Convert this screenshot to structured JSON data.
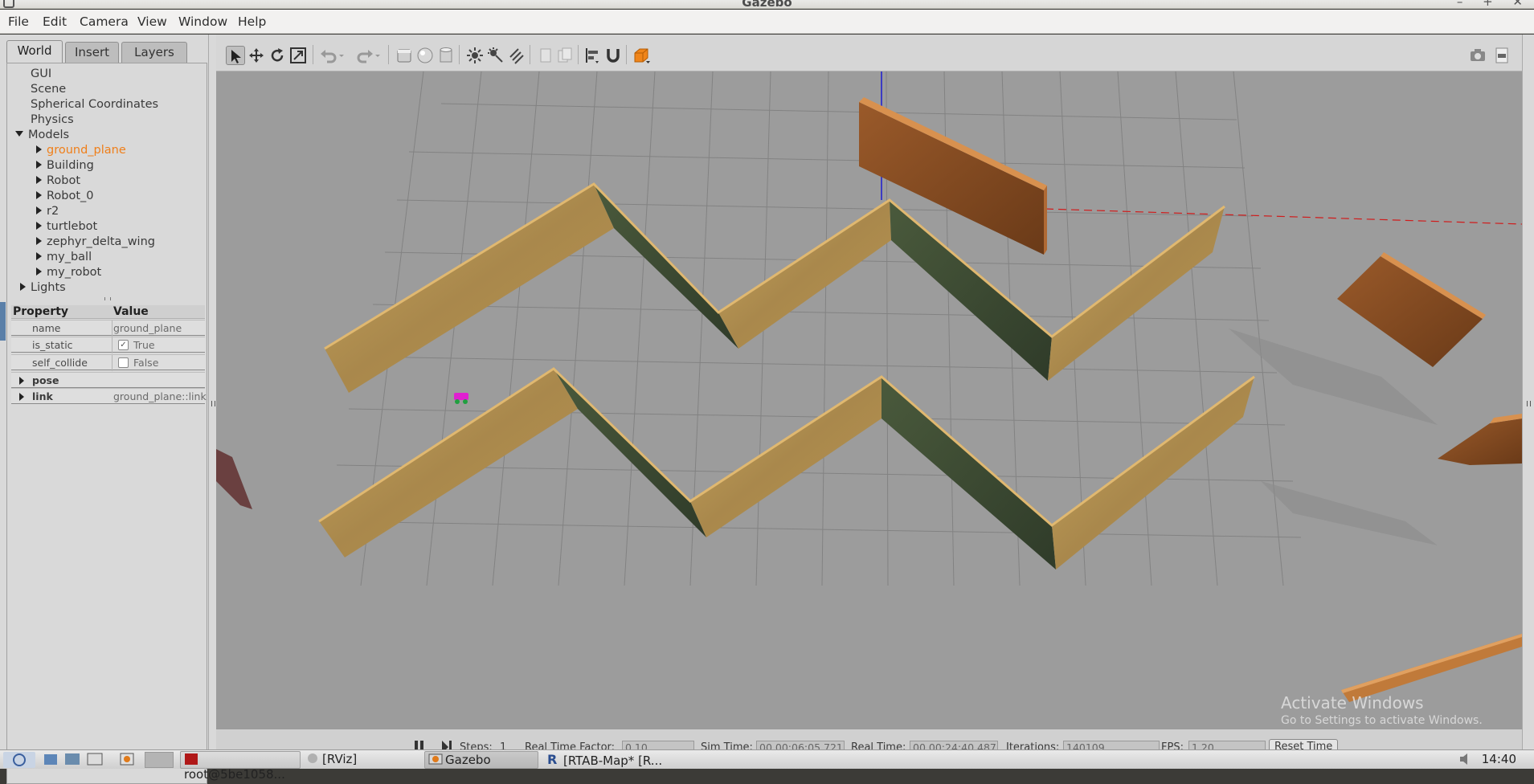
{
  "window": {
    "title": "Gazebo"
  },
  "menu": [
    "File",
    "Edit",
    "Camera",
    "View",
    "Window",
    "Help"
  ],
  "tabs": [
    "World",
    "Insert",
    "Layers"
  ],
  "tree": {
    "top_items": [
      "GUI",
      "Scene",
      "Spherical Coordinates",
      "Physics"
    ],
    "models_label": "Models",
    "models": [
      "ground_plane",
      "Building",
      "Robot",
      "Robot_0",
      "r2",
      "turtlebot",
      "zephyr_delta_wing",
      "my_ball",
      "my_robot"
    ],
    "lights_label": "Lights",
    "selected": "ground_plane"
  },
  "properties": {
    "header_property": "Property",
    "header_value": "Value",
    "rows": [
      {
        "key": "name",
        "value": "ground_plane"
      },
      {
        "key": "is_static",
        "value": "True",
        "checked": true
      },
      {
        "key": "self_collide",
        "value": "False",
        "checked": false
      }
    ],
    "groups": [
      {
        "key": "pose",
        "value": ""
      },
      {
        "key": "link",
        "value": "ground_plane::link"
      }
    ]
  },
  "toolbar": {
    "icons": [
      "select-arrow-icon",
      "translate-icon",
      "rotate-icon",
      "scale-icon",
      "undo-icon",
      "redo-icon",
      "box-icon",
      "sphere-icon",
      "cylinder-icon",
      "point-light-icon",
      "spot-light-icon",
      "directional-light-icon",
      "copy-icon",
      "paste-icon",
      "align-icon",
      "snap-icon",
      "view-angle-icon",
      "screenshot-icon",
      "log-icon"
    ]
  },
  "status": {
    "steps_label": "Steps:",
    "steps_value": "1",
    "rtf_label": "Real Time Factor:",
    "rtf_value": "0.10",
    "sim_time_label": "Sim Time:",
    "sim_time_value": "00 00:06:05.721",
    "real_time_label": "Real Time:",
    "real_time_value": "00 00:24:40.487",
    "iterations_label": "Iterations:",
    "iterations_value": "140109",
    "fps_label": "FPS:",
    "fps_value": "1.20",
    "reset_label": "Reset Time"
  },
  "watermark": {
    "line1": "Activate Windows",
    "line2": "Go to Settings to activate Windows."
  },
  "taskbar": {
    "items": [
      "root@5be1058...",
      "[RViz]",
      "Gazebo",
      "[RTAB-Map* [R..."
    ],
    "clock": "14:40"
  },
  "colors": {
    "selected_text": "#ef7f1a",
    "viewport_bg": "#9c9c9c",
    "panel_bg": "#d9d9d9",
    "wall_wood": "#b8944e",
    "wall_dark": "#3d4a32"
  }
}
